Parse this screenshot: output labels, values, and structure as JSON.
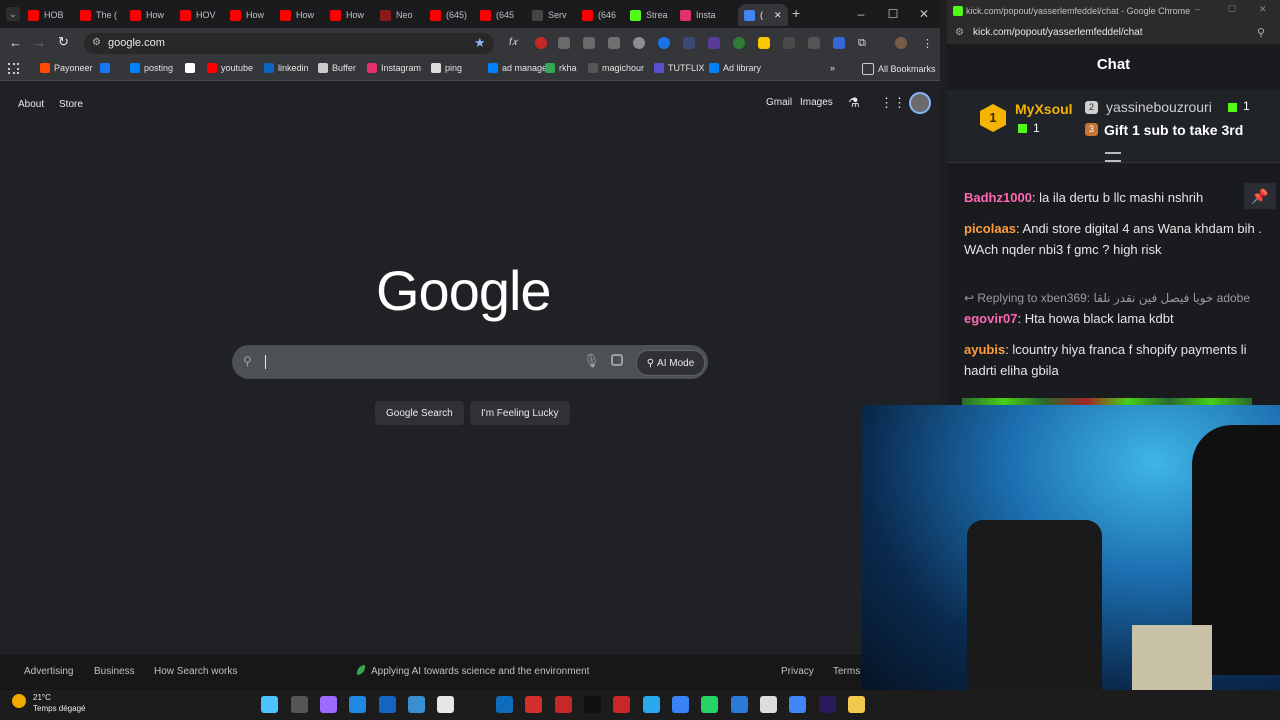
{
  "tabs": [
    {
      "label": "HOB",
      "color": "#ff0000"
    },
    {
      "label": "The (",
      "color": "#ff0000"
    },
    {
      "label": "How",
      "color": "#ff0000"
    },
    {
      "label": "HOV",
      "color": "#ff0000"
    },
    {
      "label": "How",
      "color": "#ff0000"
    },
    {
      "label": "How",
      "color": "#ff0000"
    },
    {
      "label": "How",
      "color": "#ff0000"
    },
    {
      "label": "Neo",
      "color": "#8b1a1a"
    },
    {
      "label": "(645)",
      "color": "#ff0000"
    },
    {
      "label": "(645",
      "color": "#ff0000"
    },
    {
      "label": "Serv",
      "color": "#444444"
    },
    {
      "label": "(646",
      "color": "#ff0000"
    },
    {
      "label": "Strea",
      "color": "#53fc18"
    },
    {
      "label": "Insta",
      "color": "#e1306c"
    },
    {
      "label": "(",
      "color": "#4285f4"
    }
  ],
  "omnibox": {
    "url": "google.com"
  },
  "bookmarks": [
    {
      "label": "Payoneer",
      "color": "#ff4800"
    },
    {
      "label": "",
      "color": "#1877f2"
    },
    {
      "label": "posting",
      "color": "#0081fb"
    },
    {
      "label": "",
      "color": "#ffffff"
    },
    {
      "label": "youtube",
      "color": "#ff0000"
    },
    {
      "label": "linkedin",
      "color": "#0a66c2"
    },
    {
      "label": "Buffer",
      "color": "#cccccc"
    },
    {
      "label": "Instagram",
      "color": "#e1306c"
    },
    {
      "label": "ping",
      "color": "#dddddd"
    },
    {
      "label": "ad manager",
      "color": "#0081fb"
    },
    {
      "label": "rkha",
      "color": "#34a853"
    },
    {
      "label": "magichour",
      "color": "#555555"
    },
    {
      "label": "TUTFLIX",
      "color": "#5a4fcf"
    },
    {
      "label": "Ad library",
      "color": "#0081fb"
    }
  ],
  "all_bookmarks": "All Bookmarks",
  "google": {
    "about": "About",
    "store": "Store",
    "gmail": "Gmail",
    "images": "Images",
    "logo": "Google",
    "ai_mode": "AI Mode",
    "search_btn": "Google Search",
    "lucky_btn": "I'm Feeling Lucky",
    "footer": {
      "advertising": "Advertising",
      "business": "Business",
      "how": "How Search works",
      "ai": "Applying AI towards science and the environment",
      "privacy": "Privacy",
      "terms": "Terms"
    }
  },
  "popout": {
    "title": "kick.com/popout/yasserlemfeddel/chat - Google Chrome",
    "url": "kick.com/popout/yasserlemfeddel/chat",
    "chat_title": "Chat",
    "pinned": {
      "rank1_name": "MyXsoul",
      "rank1_count": "1",
      "rank2_name": "yassinebouzrouri",
      "rank2_count": "1",
      "gift_text": "Gift 1 sub to take 3rd"
    },
    "messages": [
      {
        "user": "Badhz1000",
        "color": "#ff69b4",
        "text": "la ila dertu b llc mashi nshrih"
      },
      {
        "user": "picolaas",
        "color": "#ff9d3c",
        "text": "Andi store digital 4 ans Wana khdam bih . WAch nqder nbi3 f gmc ? high risk"
      },
      {
        "user": "egovir07",
        "color": "#ff69b4",
        "text": "Hta howa black lama kdbt"
      },
      {
        "user": "ayubis",
        "color": "#ff9d3c",
        "text": "lcountry hiya franca f shopify payments li hadrti eliha gbila"
      }
    ],
    "reply": "Replying to xben369: خويا فيصل فين نقدر نلقا adobe"
  },
  "taskbar": {
    "temp": "21°C",
    "weather": "Temps dégagé"
  }
}
